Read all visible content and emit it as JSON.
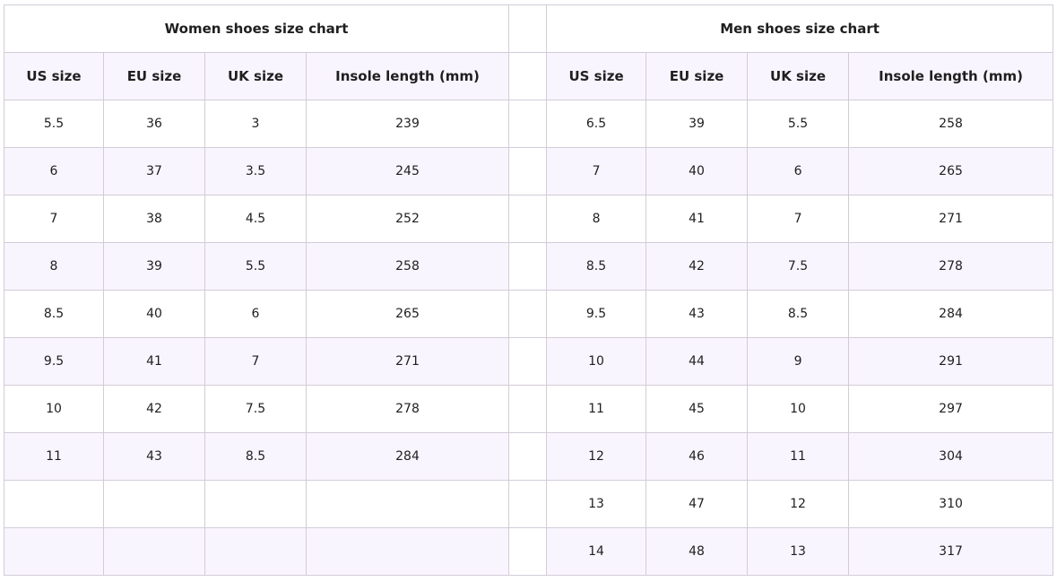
{
  "women": {
    "title": "Women shoes size chart",
    "headers": [
      "US size",
      "EU size",
      "UK size",
      "Insole length (mm)"
    ],
    "rows": [
      [
        "5.5",
        "36",
        "3",
        "239"
      ],
      [
        "6",
        "37",
        "3.5",
        "245"
      ],
      [
        "7",
        "38",
        "4.5",
        "252"
      ],
      [
        "8",
        "39",
        "5.5",
        "258"
      ],
      [
        "8.5",
        "40",
        "6",
        "265"
      ],
      [
        "9.5",
        "41",
        "7",
        "271"
      ],
      [
        "10",
        "42",
        "7.5",
        "278"
      ],
      [
        "11",
        "43",
        "8.5",
        "284"
      ],
      [
        "",
        "",
        "",
        ""
      ],
      [
        "",
        "",
        "",
        ""
      ]
    ]
  },
  "men": {
    "title": "Men shoes size chart",
    "headers": [
      "US size",
      "EU size",
      "UK size",
      "Insole length (mm)"
    ],
    "rows": [
      [
        "6.5",
        "39",
        "5.5",
        "258"
      ],
      [
        "7",
        "40",
        "6",
        "265"
      ],
      [
        "8",
        "41",
        "7",
        "271"
      ],
      [
        "8.5",
        "42",
        "7.5",
        "278"
      ],
      [
        "9.5",
        "43",
        "8.5",
        "284"
      ],
      [
        "10",
        "44",
        "9",
        "291"
      ],
      [
        "11",
        "45",
        "10",
        "297"
      ],
      [
        "12",
        "46",
        "11",
        "304"
      ],
      [
        "13",
        "47",
        "12",
        "310"
      ],
      [
        "14",
        "48",
        "13",
        "317"
      ]
    ]
  },
  "colors": {
    "stripe": "#f9f5fe",
    "border": "#d3ccd8"
  }
}
